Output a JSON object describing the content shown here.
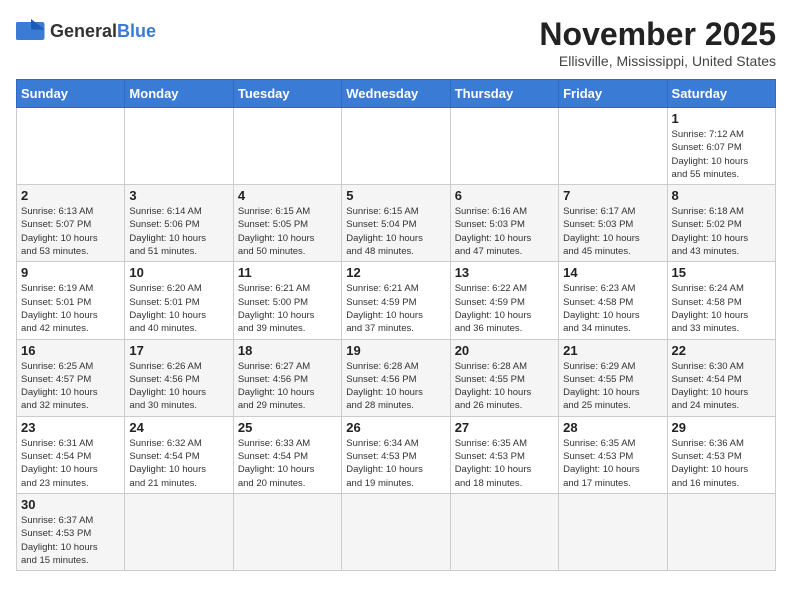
{
  "header": {
    "logo_general": "General",
    "logo_blue": "Blue",
    "month_year": "November 2025",
    "location": "Ellisville, Mississippi, United States"
  },
  "days_of_week": [
    "Sunday",
    "Monday",
    "Tuesday",
    "Wednesday",
    "Thursday",
    "Friday",
    "Saturday"
  ],
  "weeks": [
    [
      {
        "day": "",
        "info": ""
      },
      {
        "day": "",
        "info": ""
      },
      {
        "day": "",
        "info": ""
      },
      {
        "day": "",
        "info": ""
      },
      {
        "day": "",
        "info": ""
      },
      {
        "day": "",
        "info": ""
      },
      {
        "day": "1",
        "info": "Sunrise: 7:12 AM\nSunset: 6:07 PM\nDaylight: 10 hours\nand 55 minutes."
      }
    ],
    [
      {
        "day": "2",
        "info": "Sunrise: 6:13 AM\nSunset: 5:07 PM\nDaylight: 10 hours\nand 53 minutes."
      },
      {
        "day": "3",
        "info": "Sunrise: 6:14 AM\nSunset: 5:06 PM\nDaylight: 10 hours\nand 51 minutes."
      },
      {
        "day": "4",
        "info": "Sunrise: 6:15 AM\nSunset: 5:05 PM\nDaylight: 10 hours\nand 50 minutes."
      },
      {
        "day": "5",
        "info": "Sunrise: 6:15 AM\nSunset: 5:04 PM\nDaylight: 10 hours\nand 48 minutes."
      },
      {
        "day": "6",
        "info": "Sunrise: 6:16 AM\nSunset: 5:03 PM\nDaylight: 10 hours\nand 47 minutes."
      },
      {
        "day": "7",
        "info": "Sunrise: 6:17 AM\nSunset: 5:03 PM\nDaylight: 10 hours\nand 45 minutes."
      },
      {
        "day": "8",
        "info": "Sunrise: 6:18 AM\nSunset: 5:02 PM\nDaylight: 10 hours\nand 43 minutes."
      }
    ],
    [
      {
        "day": "9",
        "info": "Sunrise: 6:19 AM\nSunset: 5:01 PM\nDaylight: 10 hours\nand 42 minutes."
      },
      {
        "day": "10",
        "info": "Sunrise: 6:20 AM\nSunset: 5:01 PM\nDaylight: 10 hours\nand 40 minutes."
      },
      {
        "day": "11",
        "info": "Sunrise: 6:21 AM\nSunset: 5:00 PM\nDaylight: 10 hours\nand 39 minutes."
      },
      {
        "day": "12",
        "info": "Sunrise: 6:21 AM\nSunset: 4:59 PM\nDaylight: 10 hours\nand 37 minutes."
      },
      {
        "day": "13",
        "info": "Sunrise: 6:22 AM\nSunset: 4:59 PM\nDaylight: 10 hours\nand 36 minutes."
      },
      {
        "day": "14",
        "info": "Sunrise: 6:23 AM\nSunset: 4:58 PM\nDaylight: 10 hours\nand 34 minutes."
      },
      {
        "day": "15",
        "info": "Sunrise: 6:24 AM\nSunset: 4:58 PM\nDaylight: 10 hours\nand 33 minutes."
      }
    ],
    [
      {
        "day": "16",
        "info": "Sunrise: 6:25 AM\nSunset: 4:57 PM\nDaylight: 10 hours\nand 32 minutes."
      },
      {
        "day": "17",
        "info": "Sunrise: 6:26 AM\nSunset: 4:56 PM\nDaylight: 10 hours\nand 30 minutes."
      },
      {
        "day": "18",
        "info": "Sunrise: 6:27 AM\nSunset: 4:56 PM\nDaylight: 10 hours\nand 29 minutes."
      },
      {
        "day": "19",
        "info": "Sunrise: 6:28 AM\nSunset: 4:56 PM\nDaylight: 10 hours\nand 28 minutes."
      },
      {
        "day": "20",
        "info": "Sunrise: 6:28 AM\nSunset: 4:55 PM\nDaylight: 10 hours\nand 26 minutes."
      },
      {
        "day": "21",
        "info": "Sunrise: 6:29 AM\nSunset: 4:55 PM\nDaylight: 10 hours\nand 25 minutes."
      },
      {
        "day": "22",
        "info": "Sunrise: 6:30 AM\nSunset: 4:54 PM\nDaylight: 10 hours\nand 24 minutes."
      }
    ],
    [
      {
        "day": "23",
        "info": "Sunrise: 6:31 AM\nSunset: 4:54 PM\nDaylight: 10 hours\nand 23 minutes."
      },
      {
        "day": "24",
        "info": "Sunrise: 6:32 AM\nSunset: 4:54 PM\nDaylight: 10 hours\nand 21 minutes."
      },
      {
        "day": "25",
        "info": "Sunrise: 6:33 AM\nSunset: 4:54 PM\nDaylight: 10 hours\nand 20 minutes."
      },
      {
        "day": "26",
        "info": "Sunrise: 6:34 AM\nSunset: 4:53 PM\nDaylight: 10 hours\nand 19 minutes."
      },
      {
        "day": "27",
        "info": "Sunrise: 6:35 AM\nSunset: 4:53 PM\nDaylight: 10 hours\nand 18 minutes."
      },
      {
        "day": "28",
        "info": "Sunrise: 6:35 AM\nSunset: 4:53 PM\nDaylight: 10 hours\nand 17 minutes."
      },
      {
        "day": "29",
        "info": "Sunrise: 6:36 AM\nSunset: 4:53 PM\nDaylight: 10 hours\nand 16 minutes."
      }
    ],
    [
      {
        "day": "30",
        "info": "Sunrise: 6:37 AM\nSunset: 4:53 PM\nDaylight: 10 hours\nand 15 minutes."
      },
      {
        "day": "",
        "info": ""
      },
      {
        "day": "",
        "info": ""
      },
      {
        "day": "",
        "info": ""
      },
      {
        "day": "",
        "info": ""
      },
      {
        "day": "",
        "info": ""
      },
      {
        "day": "",
        "info": ""
      }
    ]
  ]
}
